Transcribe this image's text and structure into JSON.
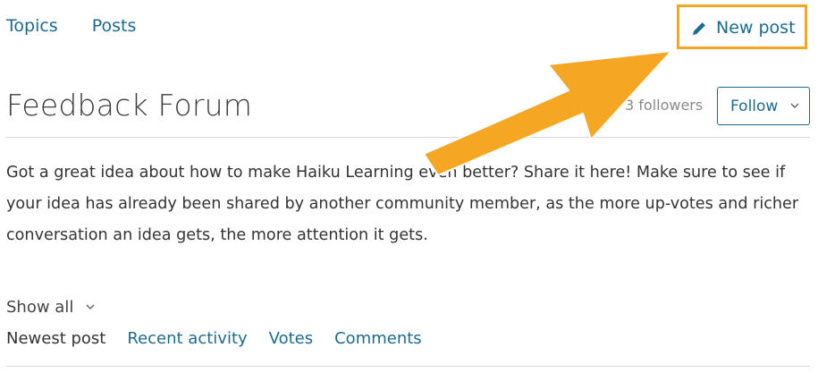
{
  "nav": {
    "topics": "Topics",
    "posts": "Posts"
  },
  "actions": {
    "new_post": "New post"
  },
  "forum": {
    "title": "Feedback Forum",
    "followers": "3 followers",
    "follow": "Follow",
    "description": "Got a great idea about how to make Haiku Learning even better? Share it here! Make sure to see if your idea has already been shared by another community member, as the more up-votes and richer conversation an idea gets, the more attention it gets."
  },
  "filters": {
    "show_all": "Show all",
    "sort_active": "Newest post",
    "sort_options": [
      "Recent activity",
      "Votes",
      "Comments"
    ]
  },
  "colors": {
    "link": "#1a6b8f",
    "highlight": "#f5a623"
  },
  "icons": {
    "new_post": "pencil-icon",
    "follow_dropdown": "chevron-down-icon",
    "show_all_dropdown": "chevron-down-icon",
    "annotation": "arrow-annotation"
  }
}
